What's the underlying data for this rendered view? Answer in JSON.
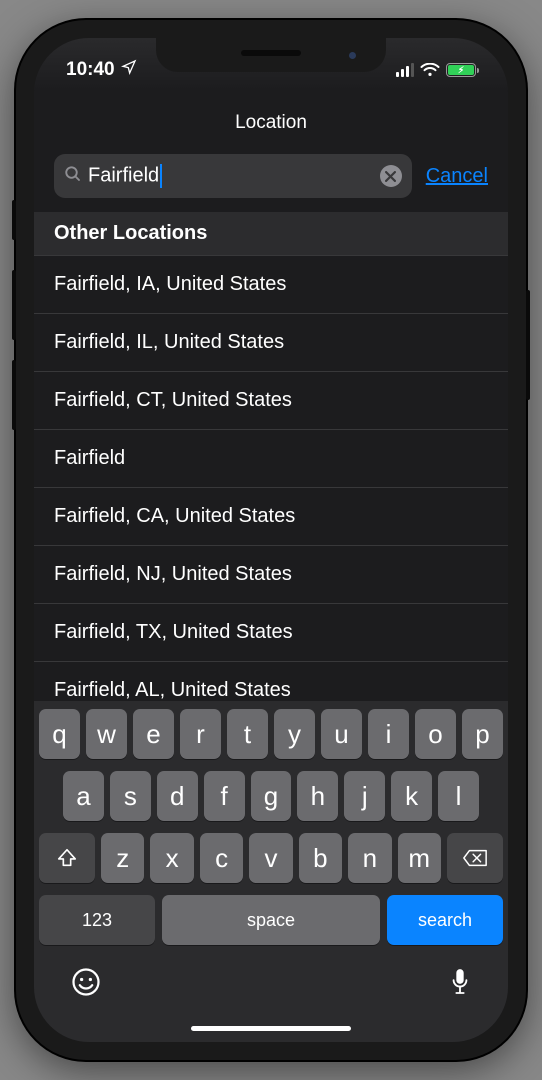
{
  "status": {
    "time": "10:40",
    "location_services": true
  },
  "nav": {
    "title": "Location"
  },
  "search": {
    "value": "Fairfield",
    "cancel_label": "Cancel"
  },
  "section_header": "Other Locations",
  "results": [
    "Fairfield, IA, United States",
    "Fairfield, IL, United States",
    "Fairfield, CT, United States",
    "Fairfield",
    "Fairfield, CA, United States",
    "Fairfield, NJ, United States",
    "Fairfield, TX, United States",
    "Fairfield, AL, United States"
  ],
  "keyboard": {
    "row1": [
      "q",
      "w",
      "e",
      "r",
      "t",
      "y",
      "u",
      "i",
      "o",
      "p"
    ],
    "row2": [
      "a",
      "s",
      "d",
      "f",
      "g",
      "h",
      "j",
      "k",
      "l"
    ],
    "row3": [
      "z",
      "x",
      "c",
      "v",
      "b",
      "n",
      "m"
    ],
    "numeric_label": "123",
    "space_label": "space",
    "action_label": "search"
  }
}
